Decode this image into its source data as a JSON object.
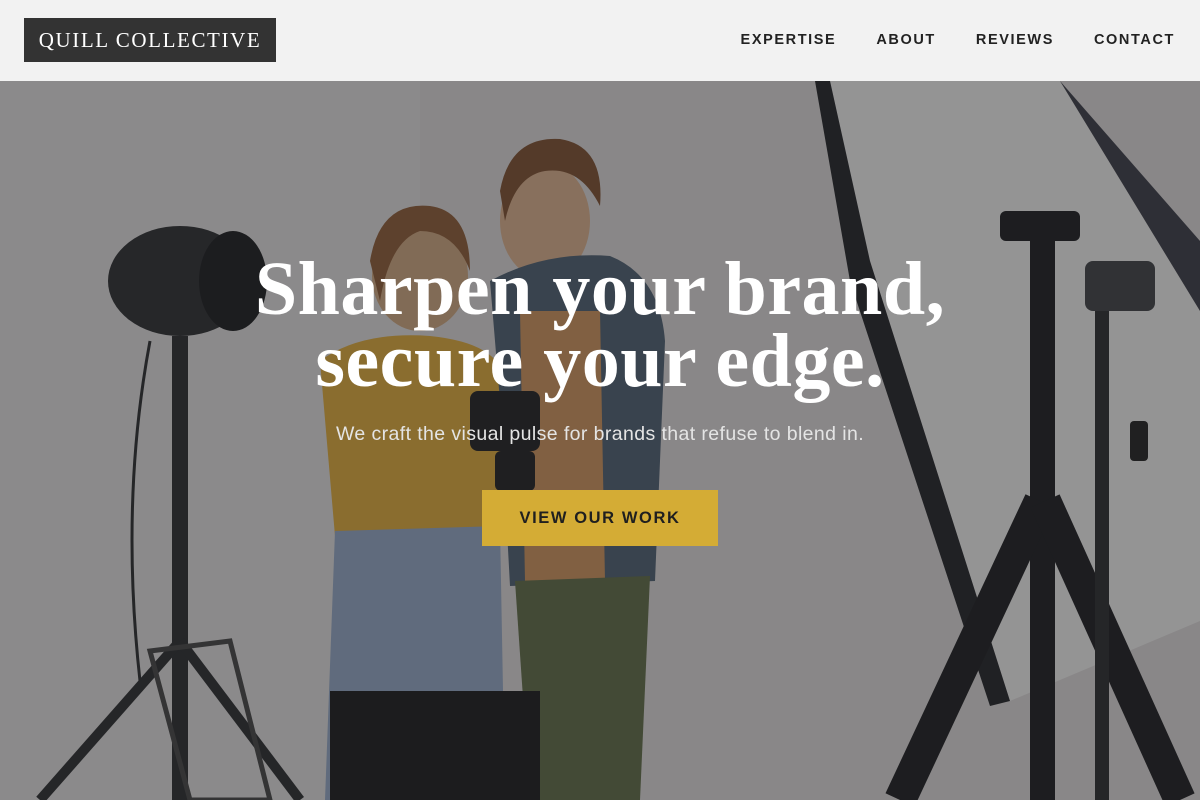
{
  "brand": {
    "name": "QUILL COLLECTIVE"
  },
  "nav": {
    "items": [
      {
        "label": "EXPERTISE"
      },
      {
        "label": "ABOUT"
      },
      {
        "label": "REVIEWS"
      },
      {
        "label": "CONTACT"
      }
    ]
  },
  "hero": {
    "title_line1": "Sharpen your brand,",
    "title_line2": "secure your edge.",
    "subtitle": "We craft the visual pulse for brands that refuse to blend in.",
    "cta_label": "VIEW OUR WORK",
    "background_image": "photo-studio-photographers",
    "colors": {
      "accent": "#d4ac35",
      "header_bg": "#f2f2f2",
      "logo_bg": "#333333"
    }
  }
}
